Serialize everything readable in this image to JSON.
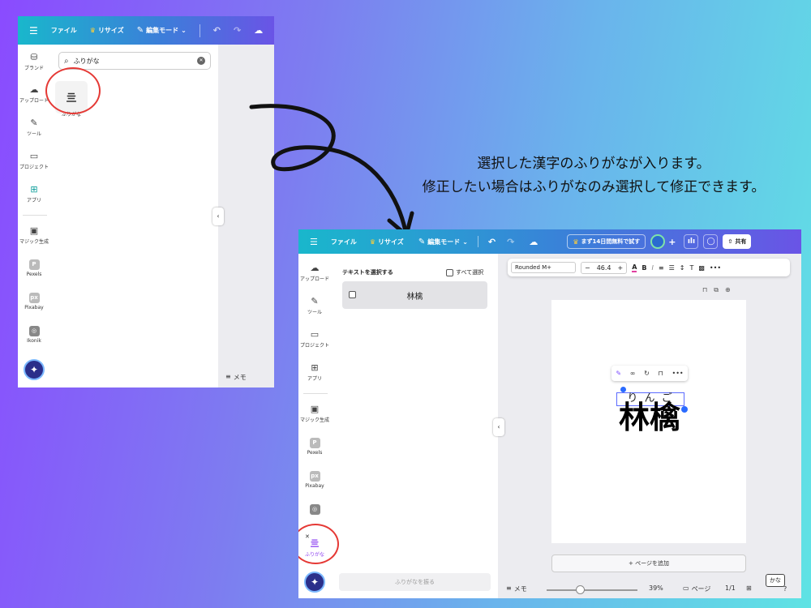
{
  "annotation": {
    "line1": "選択した漢字のふりがなが入ります。",
    "line2": "修正したい場合はふりがなのみ選択して修正できます。"
  },
  "left_screen": {
    "toolbar": {
      "file": "ファイル",
      "resize": "リサイズ",
      "edit_mode": "編集モード"
    },
    "sidebar": {
      "items": [
        "ブランド",
        "アップロード",
        "ツール",
        "プロジェクト",
        "アプリ",
        "マジック生成",
        "Pexels",
        "Pixabay",
        "Ikonik"
      ]
    },
    "search": {
      "value": "ふりがな"
    },
    "result_label": "ふりがな",
    "footer": {
      "memo": "メモ"
    }
  },
  "right_screen": {
    "toolbar": {
      "file": "ファイル",
      "resize": "リサイズ",
      "edit_mode": "編集モード",
      "trial": "まず14日間無料で試す",
      "share": "共有"
    },
    "sidebar": {
      "items": [
        "アップロード",
        "ツール",
        "プロジェクト",
        "アプリ",
        "マジック生成",
        "Pexels",
        "Pixabay"
      ],
      "app_label": "ふりがな"
    },
    "panel": {
      "select_text": "テキストを選択する",
      "select_all": "すべて選択",
      "row_text": "林檎",
      "apply_button": "ふりがなを振る"
    },
    "format_bar": {
      "font": "Rounded M+",
      "size": "46.4"
    },
    "canvas": {
      "ruby": "り ん ご",
      "base": "林檎",
      "add_page": "ページを追加"
    },
    "footer": {
      "memo": "メモ",
      "zoom": "39%",
      "page_label": "ページ",
      "page_count": "1/1",
      "kana": "かな"
    }
  }
}
